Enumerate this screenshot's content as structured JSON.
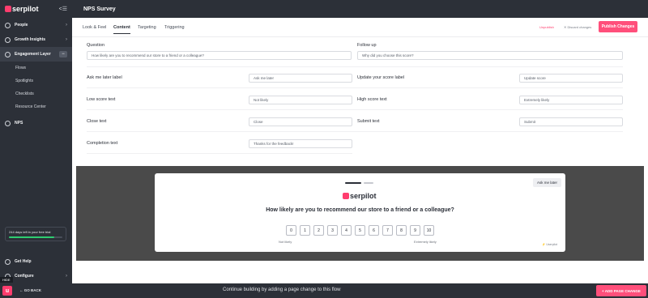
{
  "sidebar": {
    "logo_text": "serpilot",
    "items": [
      {
        "label": "People"
      },
      {
        "label": "Growth Insights"
      },
      {
        "label": "Engagement Layer"
      }
    ],
    "sub_items": [
      {
        "label": "Flows"
      },
      {
        "label": "Spotlights"
      },
      {
        "label": "Checklists"
      },
      {
        "label": "Resource Center"
      }
    ],
    "nps_label": "NPS",
    "trial_text": "244 days left in your free trial",
    "trial_progress": 0.85,
    "help_label": "Get Help",
    "configure_label": "Configure",
    "hide_label": "HIDE"
  },
  "topbar": {
    "title": "NPS Survey"
  },
  "tabs": [
    {
      "label": "Look & Feel"
    },
    {
      "label": "Content"
    },
    {
      "label": "Targeting"
    },
    {
      "label": "Triggering"
    }
  ],
  "actions": {
    "unpublish": "Unpublish",
    "discard": "✕ Discard changes",
    "publish": "Publish Changes"
  },
  "form": {
    "question_label": "Question",
    "question_value": "How likely are you to recommend our store to a friend or a colleague?",
    "followup_label": "Follow up",
    "followup_value": "Why did you choose this score?",
    "ask_later_label": "Ask me later label",
    "ask_later_value": "Ask me later",
    "update_score_label": "Update your score label",
    "update_score_value": "Update score",
    "low_score_label": "Low score text",
    "low_score_value": "Not likely",
    "high_score_label": "High score text",
    "high_score_value": "Extremely likely",
    "close_label": "Close text",
    "close_value": "Close",
    "submit_label": "Submit text",
    "submit_value": "Submit",
    "completion_label": "Completion text",
    "completion_value": "Thanks for the feedback!"
  },
  "preview": {
    "ask_later": "Ask me later",
    "logo_text": "serpilot",
    "question": "How likely are you to recommend our store to a friend or a colleague?",
    "scale": [
      "0",
      "1",
      "2",
      "3",
      "4",
      "5",
      "6",
      "7",
      "8",
      "9",
      "10"
    ],
    "low": "Not likely",
    "high": "Extremely likely",
    "powered": "⚡ Userpilot"
  },
  "bottombar": {
    "logo": "u",
    "go_back": "← GO BACK",
    "message": "Continue building by adding a page change to this flow",
    "add_change": "+ ADD PAGE CHANGE"
  },
  "colors": {
    "accent": "#ff4f7b",
    "sidebar": "#2c3038",
    "preview_bg": "#4a4a4a"
  }
}
